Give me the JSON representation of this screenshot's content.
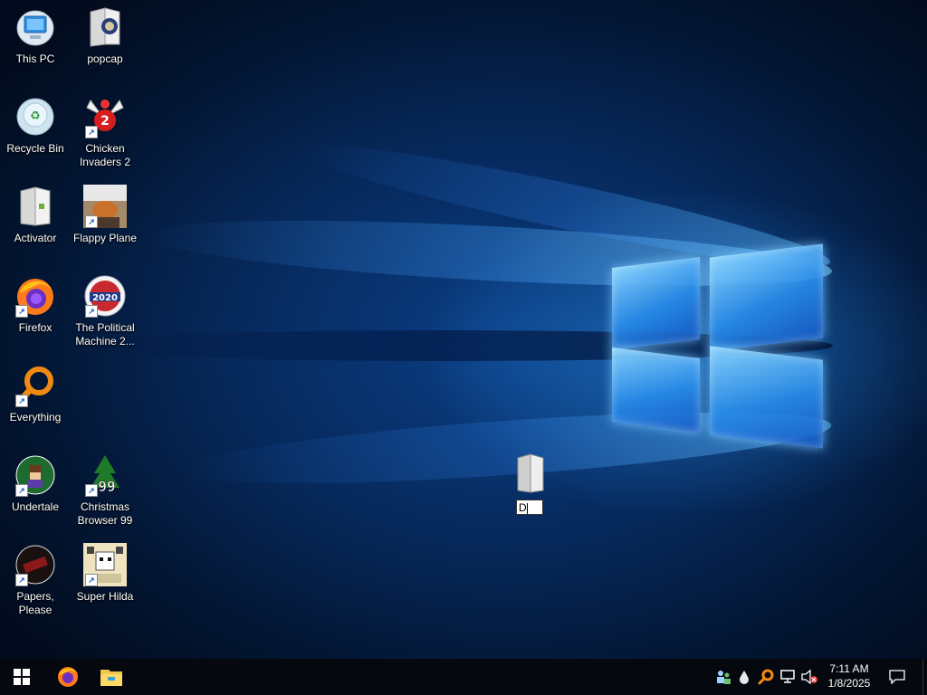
{
  "desktop": {
    "icons": [
      {
        "label": "This PC",
        "icon": "computer-icon"
      },
      {
        "label": "popcap",
        "icon": "folder-icon"
      },
      {
        "label": "Recycle Bin",
        "icon": "recycle-bin-icon"
      },
      {
        "label": "Chicken Invaders 2",
        "icon": "chicken-icon"
      },
      {
        "label": "Activator",
        "icon": "file-icon"
      },
      {
        "label": "Flappy Plane",
        "icon": "flappy-plane-icon"
      },
      {
        "label": "Firefox",
        "icon": "firefox-icon"
      },
      {
        "label": "The Political Machine 2...",
        "icon": "political-machine-icon",
        "badge": "2020"
      },
      {
        "label": "Everything",
        "icon": "everything-search-icon"
      },
      {
        "label": "Undertale",
        "icon": "undertale-icon"
      },
      {
        "label": "Christmas Browser 99",
        "icon": "christmas-tree-icon",
        "badge": "99"
      },
      {
        "label": "Papers, Please",
        "icon": "papers-please-icon"
      },
      {
        "label": "Super Hilda",
        "icon": "super-hilda-icon"
      }
    ],
    "rename_item": {
      "value": "D",
      "icon": "folder-icon"
    }
  },
  "taskbar": {
    "start": {
      "icon": "windows-start-icon"
    },
    "pinned": [
      {
        "icon": "firefox-icon"
      },
      {
        "icon": "file-explorer-icon"
      }
    ],
    "tray": [
      {
        "icon": "people-network-icon"
      },
      {
        "icon": "water-drop-icon"
      },
      {
        "icon": "search-magnifier-icon"
      },
      {
        "icon": "network-icon"
      },
      {
        "icon": "volume-muted-icon"
      }
    ],
    "clock": {
      "time": "7:11 AM",
      "date": "1/8/2025"
    },
    "notifications": {
      "icon": "action-center-icon"
    }
  },
  "colors": {
    "wallpaper_dark": "#021530",
    "wallpaper_glow": "#2a8ce6",
    "taskbar": "#05080f",
    "label_text": "#ffffff"
  }
}
